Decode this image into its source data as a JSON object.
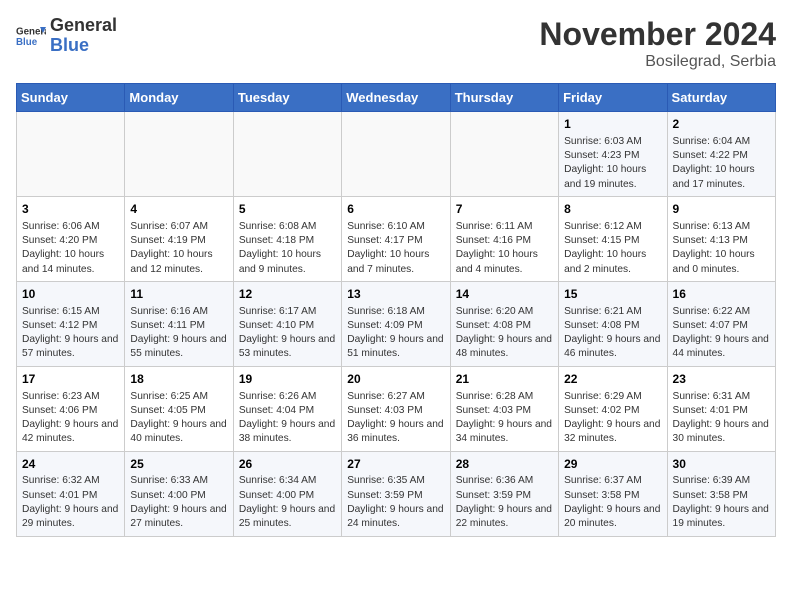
{
  "header": {
    "logo_general": "General",
    "logo_blue": "Blue",
    "month_title": "November 2024",
    "location": "Bosilegrad, Serbia"
  },
  "days_of_week": [
    "Sunday",
    "Monday",
    "Tuesday",
    "Wednesday",
    "Thursday",
    "Friday",
    "Saturday"
  ],
  "weeks": [
    [
      {
        "day": "",
        "info": ""
      },
      {
        "day": "",
        "info": ""
      },
      {
        "day": "",
        "info": ""
      },
      {
        "day": "",
        "info": ""
      },
      {
        "day": "",
        "info": ""
      },
      {
        "day": "1",
        "info": "Sunrise: 6:03 AM\nSunset: 4:23 PM\nDaylight: 10 hours and 19 minutes."
      },
      {
        "day": "2",
        "info": "Sunrise: 6:04 AM\nSunset: 4:22 PM\nDaylight: 10 hours and 17 minutes."
      }
    ],
    [
      {
        "day": "3",
        "info": "Sunrise: 6:06 AM\nSunset: 4:20 PM\nDaylight: 10 hours and 14 minutes."
      },
      {
        "day": "4",
        "info": "Sunrise: 6:07 AM\nSunset: 4:19 PM\nDaylight: 10 hours and 12 minutes."
      },
      {
        "day": "5",
        "info": "Sunrise: 6:08 AM\nSunset: 4:18 PM\nDaylight: 10 hours and 9 minutes."
      },
      {
        "day": "6",
        "info": "Sunrise: 6:10 AM\nSunset: 4:17 PM\nDaylight: 10 hours and 7 minutes."
      },
      {
        "day": "7",
        "info": "Sunrise: 6:11 AM\nSunset: 4:16 PM\nDaylight: 10 hours and 4 minutes."
      },
      {
        "day": "8",
        "info": "Sunrise: 6:12 AM\nSunset: 4:15 PM\nDaylight: 10 hours and 2 minutes."
      },
      {
        "day": "9",
        "info": "Sunrise: 6:13 AM\nSunset: 4:13 PM\nDaylight: 10 hours and 0 minutes."
      }
    ],
    [
      {
        "day": "10",
        "info": "Sunrise: 6:15 AM\nSunset: 4:12 PM\nDaylight: 9 hours and 57 minutes."
      },
      {
        "day": "11",
        "info": "Sunrise: 6:16 AM\nSunset: 4:11 PM\nDaylight: 9 hours and 55 minutes."
      },
      {
        "day": "12",
        "info": "Sunrise: 6:17 AM\nSunset: 4:10 PM\nDaylight: 9 hours and 53 minutes."
      },
      {
        "day": "13",
        "info": "Sunrise: 6:18 AM\nSunset: 4:09 PM\nDaylight: 9 hours and 51 minutes."
      },
      {
        "day": "14",
        "info": "Sunrise: 6:20 AM\nSunset: 4:08 PM\nDaylight: 9 hours and 48 minutes."
      },
      {
        "day": "15",
        "info": "Sunrise: 6:21 AM\nSunset: 4:08 PM\nDaylight: 9 hours and 46 minutes."
      },
      {
        "day": "16",
        "info": "Sunrise: 6:22 AM\nSunset: 4:07 PM\nDaylight: 9 hours and 44 minutes."
      }
    ],
    [
      {
        "day": "17",
        "info": "Sunrise: 6:23 AM\nSunset: 4:06 PM\nDaylight: 9 hours and 42 minutes."
      },
      {
        "day": "18",
        "info": "Sunrise: 6:25 AM\nSunset: 4:05 PM\nDaylight: 9 hours and 40 minutes."
      },
      {
        "day": "19",
        "info": "Sunrise: 6:26 AM\nSunset: 4:04 PM\nDaylight: 9 hours and 38 minutes."
      },
      {
        "day": "20",
        "info": "Sunrise: 6:27 AM\nSunset: 4:03 PM\nDaylight: 9 hours and 36 minutes."
      },
      {
        "day": "21",
        "info": "Sunrise: 6:28 AM\nSunset: 4:03 PM\nDaylight: 9 hours and 34 minutes."
      },
      {
        "day": "22",
        "info": "Sunrise: 6:29 AM\nSunset: 4:02 PM\nDaylight: 9 hours and 32 minutes."
      },
      {
        "day": "23",
        "info": "Sunrise: 6:31 AM\nSunset: 4:01 PM\nDaylight: 9 hours and 30 minutes."
      }
    ],
    [
      {
        "day": "24",
        "info": "Sunrise: 6:32 AM\nSunset: 4:01 PM\nDaylight: 9 hours and 29 minutes."
      },
      {
        "day": "25",
        "info": "Sunrise: 6:33 AM\nSunset: 4:00 PM\nDaylight: 9 hours and 27 minutes."
      },
      {
        "day": "26",
        "info": "Sunrise: 6:34 AM\nSunset: 4:00 PM\nDaylight: 9 hours and 25 minutes."
      },
      {
        "day": "27",
        "info": "Sunrise: 6:35 AM\nSunset: 3:59 PM\nDaylight: 9 hours and 24 minutes."
      },
      {
        "day": "28",
        "info": "Sunrise: 6:36 AM\nSunset: 3:59 PM\nDaylight: 9 hours and 22 minutes."
      },
      {
        "day": "29",
        "info": "Sunrise: 6:37 AM\nSunset: 3:58 PM\nDaylight: 9 hours and 20 minutes."
      },
      {
        "day": "30",
        "info": "Sunrise: 6:39 AM\nSunset: 3:58 PM\nDaylight: 9 hours and 19 minutes."
      }
    ]
  ]
}
